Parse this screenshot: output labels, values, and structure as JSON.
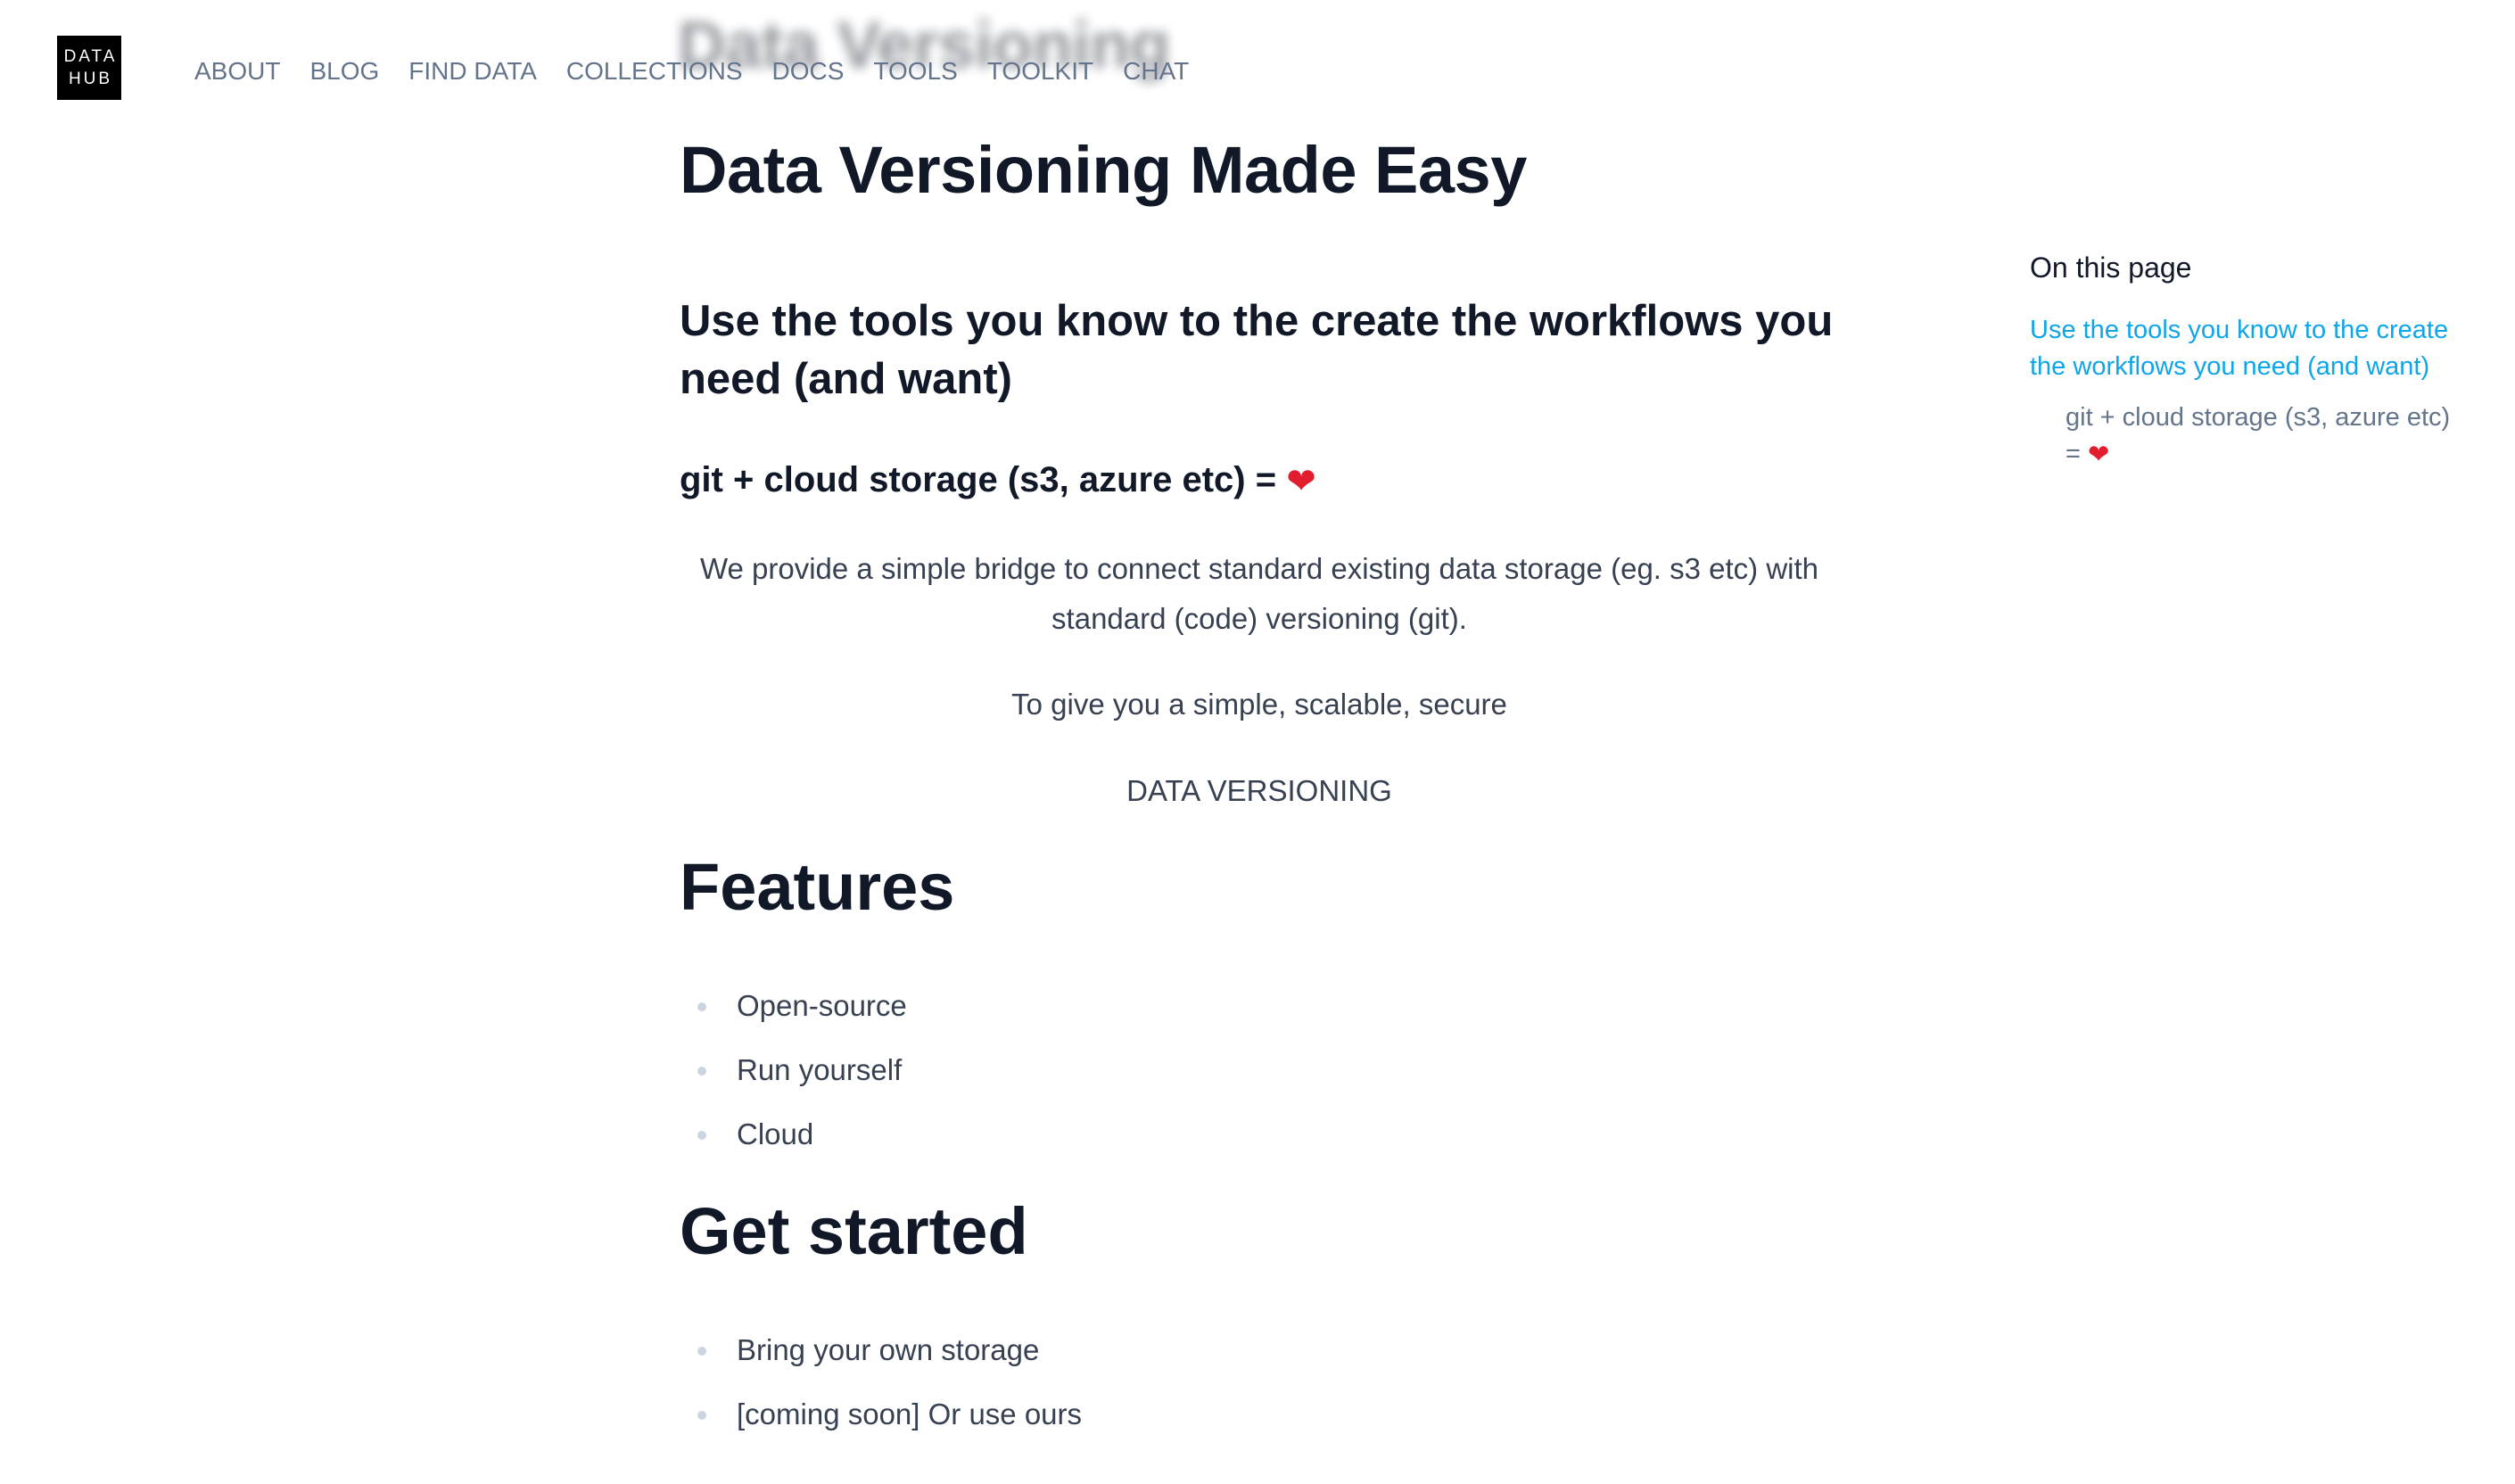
{
  "background_title": "Data Versioning",
  "header": {
    "logo_line1": "DATA",
    "logo_line2": "HUB",
    "nav": [
      "ABOUT",
      "BLOG",
      "FIND DATA",
      "COLLECTIONS",
      "DOCS",
      "TOOLS",
      "TOOLKIT",
      "CHAT"
    ]
  },
  "main": {
    "title": "Data Versioning Made Easy",
    "subtitle": "Use the tools you know to the create the workflows you need (and want)",
    "formula": "git + cloud storage (s3, azure etc) =",
    "heart": "❤",
    "paragraph1": "We provide a simple bridge to connect standard existing data storage (eg. s3 etc) with standard (code) versioning (git).",
    "paragraph2": "To give you a simple, scalable, secure",
    "paragraph3": "DATA VERSIONING",
    "features_heading": "Features",
    "features": [
      "Open-source",
      "Run yourself",
      "Cloud"
    ],
    "get_started_heading": "Get started",
    "get_started": [
      "Bring your own storage",
      "[coming soon] Or use ours"
    ]
  },
  "toc": {
    "title": "On this page",
    "link1": "Use the tools you know to the create the workflows you need (and want)",
    "link2": "git + cloud storage (s3, azure etc) ="
  },
  "colors": {
    "logo_bg": "#000000",
    "heading": "#111827",
    "nav_text": "#64748b",
    "toc_link": "#0ea5e9",
    "heart": "#e11d2e"
  },
  "icons": {
    "heart": "heart-icon",
    "bullet": "bullet-dot-icon"
  }
}
